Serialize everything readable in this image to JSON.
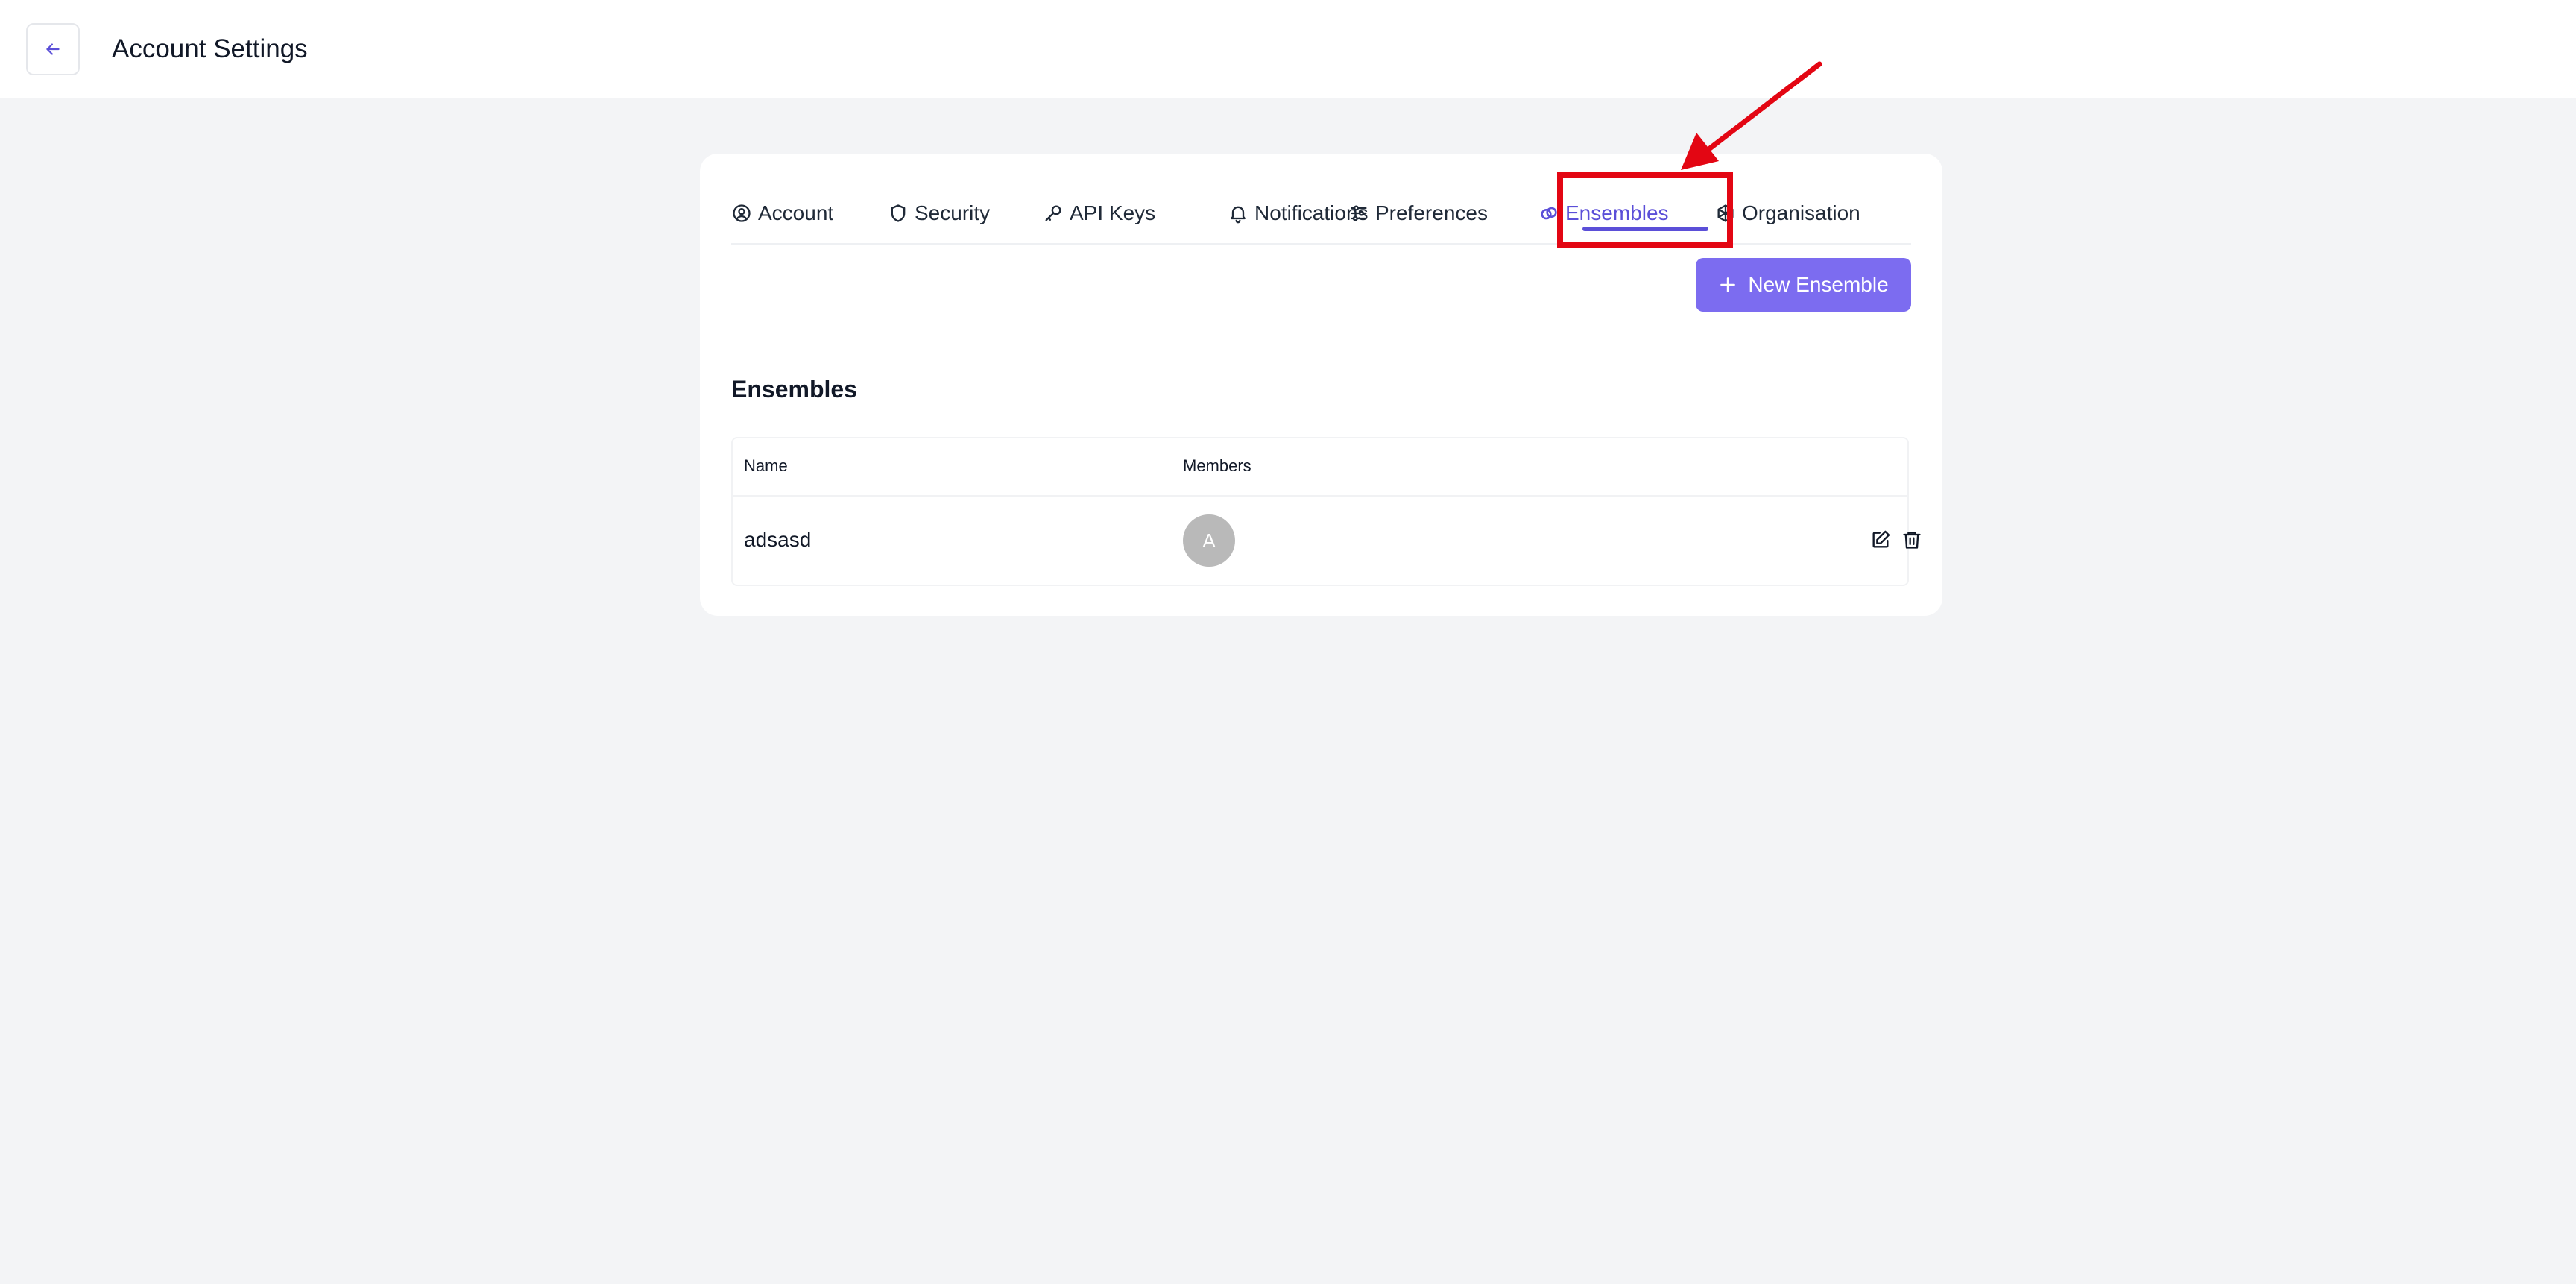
{
  "header": {
    "title": "Account Settings"
  },
  "tabs": [
    {
      "label": "Account",
      "icon": "user-circle-icon"
    },
    {
      "label": "Security",
      "icon": "shield-icon"
    },
    {
      "label": "API Keys",
      "icon": "key-icon"
    },
    {
      "label": "Notifications",
      "icon": "bell-icon"
    },
    {
      "label": "Preferences",
      "icon": "sliders-icon"
    },
    {
      "label": "Ensembles",
      "icon": "link-icon",
      "active": true
    },
    {
      "label": "Organisation",
      "icon": "hexagon-icon"
    }
  ],
  "actions": {
    "new_ensemble_label": "New Ensemble"
  },
  "ensembles": {
    "title": "Ensembles",
    "columns": [
      "Name",
      "Members"
    ],
    "rows": [
      {
        "name": "adsasd",
        "member_initial": "A"
      }
    ]
  },
  "colors": {
    "accent": "#5b4fd8",
    "button": "#7c6cf0",
    "annotation": "#e30613",
    "background": "#f3f4f6"
  }
}
